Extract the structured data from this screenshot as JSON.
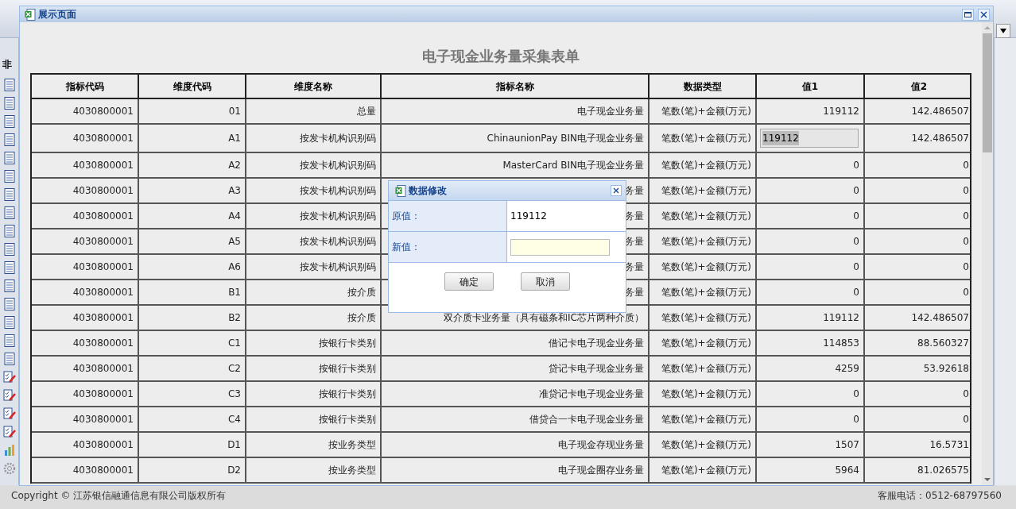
{
  "app": {
    "sidebar_heading": "非",
    "footer": {
      "copyright": "Copyright © 江苏银信融通信息有限公司版权所有",
      "phone": "客服电话：0512-68797560"
    }
  },
  "window": {
    "title": "展示页面",
    "heading": "电子现金业务量采集表单",
    "table": {
      "columns": [
        "指标代码",
        "维度代码",
        "维度名称",
        "指标名称",
        "数据类型",
        "值1",
        "值2"
      ],
      "rows": [
        {
          "editing": false,
          "cells": [
            "4030800001",
            "01",
            "总量",
            "电子现金业务量",
            "笔数(笔)+金额(万元)",
            "119112",
            "142.486507"
          ]
        },
        {
          "editing": true,
          "cells": [
            "4030800001",
            "A1",
            "按发卡机构识别码",
            "ChinaunionPay BIN电子现金业务量",
            "笔数(笔)+金额(万元)",
            "119112",
            "142.486507"
          ]
        },
        {
          "editing": false,
          "cells": [
            "4030800001",
            "A2",
            "按发卡机构识别码",
            "MasterCard BIN电子现金业务量",
            "笔数(笔)+金额(万元)",
            "0",
            "0"
          ]
        },
        {
          "editing": false,
          "cells": [
            "4030800001",
            "A3",
            "按发卡机构识别码",
            "务量",
            "笔数(笔)+金额(万元)",
            "0",
            "0"
          ]
        },
        {
          "editing": false,
          "cells": [
            "4030800001",
            "A4",
            "按发卡机构识别码",
            "务量",
            "笔数(笔)+金额(万元)",
            "0",
            "0"
          ]
        },
        {
          "editing": false,
          "cells": [
            "4030800001",
            "A5",
            "按发卡机构识别码",
            "务量",
            "笔数(笔)+金额(万元)",
            "0",
            "0"
          ]
        },
        {
          "editing": false,
          "cells": [
            "4030800001",
            "A6",
            "按发卡机构识别码",
            "务量",
            "笔数(笔)+金额(万元)",
            "0",
            "0"
          ]
        },
        {
          "editing": false,
          "cells": [
            "4030800001",
            "B1",
            "按介质",
            "务量",
            "笔数(笔)+金额(万元)",
            "0",
            "0"
          ]
        },
        {
          "editing": false,
          "cells": [
            "4030800001",
            "B2",
            "按介质",
            "双介质卡业务量（具有磁条和IC芯片两种介质）",
            "笔数(笔)+金额(万元)",
            "119112",
            "142.486507"
          ]
        },
        {
          "editing": false,
          "cells": [
            "4030800001",
            "C1",
            "按银行卡类别",
            "借记卡电子现金业务量",
            "笔数(笔)+金额(万元)",
            "114853",
            "88.560327"
          ]
        },
        {
          "editing": false,
          "cells": [
            "4030800001",
            "C2",
            "按银行卡类别",
            "贷记卡电子现金业务量",
            "笔数(笔)+金额(万元)",
            "4259",
            "53.92618"
          ]
        },
        {
          "editing": false,
          "cells": [
            "4030800001",
            "C3",
            "按银行卡类别",
            "准贷记卡电子现金业务量",
            "笔数(笔)+金额(万元)",
            "0",
            "0"
          ]
        },
        {
          "editing": false,
          "cells": [
            "4030800001",
            "C4",
            "按银行卡类别",
            "借贷合一卡电子现金业务量",
            "笔数(笔)+金额(万元)",
            "0",
            "0"
          ]
        },
        {
          "editing": false,
          "cells": [
            "4030800001",
            "D1",
            "按业务类型",
            "电子现金存现业务量",
            "笔数(笔)+金额(万元)",
            "1507",
            "16.5731"
          ]
        },
        {
          "editing": false,
          "cells": [
            "4030800001",
            "D2",
            "按业务类型",
            "电子现金圈存业务量",
            "笔数(笔)+金额(万元)",
            "5964",
            "81.026575"
          ]
        }
      ]
    }
  },
  "dialog": {
    "title": "数据修改",
    "fields": [
      {
        "kind": "text",
        "label": "原值：",
        "value": "119112"
      },
      {
        "kind": "input",
        "label": "新值："
      }
    ],
    "buttons": [
      "确定",
      "取消"
    ]
  }
}
